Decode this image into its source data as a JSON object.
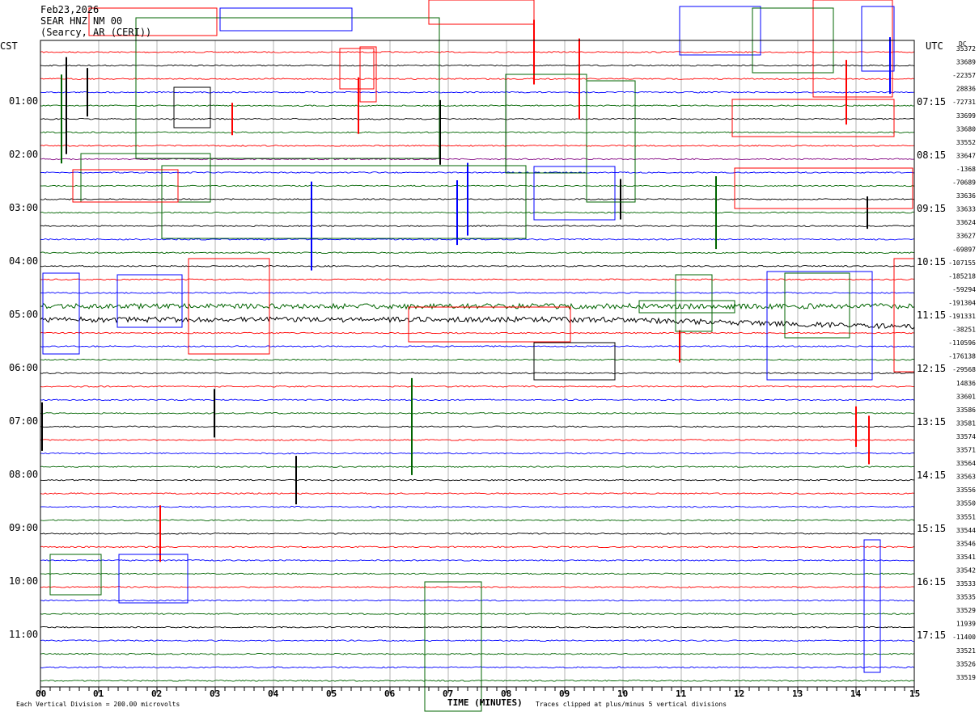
{
  "header": {
    "date": "Feb23,2026",
    "station": "SEAR HNZ NM 00",
    "location": "(Searcy, AR (CERI))"
  },
  "left_axis_title": "CST",
  "right_axis_title": "UTC",
  "dc_label": "DC",
  "footer": {
    "scale_note": "Each Vertical Division =  200.00 microvolts",
    "axis_title": "TIME (MINUTES)",
    "clip_note": "Traces clipped at plus/minus 5 vertical divisions"
  },
  "colors": {
    "palette": [
      "#000000",
      "#ff0000",
      "#0000ff",
      "#006400"
    ],
    "grid": "#808080",
    "background": "#ffffff"
  },
  "chart_data": {
    "type": "line",
    "chart_kind": "seismic helicorder",
    "x_ticks": [
      "00",
      "01",
      "02",
      "03",
      "04",
      "05",
      "06",
      "07",
      "08",
      "09",
      "10",
      "11",
      "12",
      "13",
      "14",
      "15"
    ],
    "x_range_minutes": [
      0,
      15
    ],
    "grid": true,
    "line_minutes": 15,
    "lines_per_hour": 4,
    "cst_hour_labels": [
      "01:00",
      "02:00",
      "03:00",
      "04:00",
      "05:00",
      "06:00",
      "07:00",
      "08:00",
      "09:00",
      "10:00",
      "11:00"
    ],
    "utc_hour_labels": [
      "07:15",
      "08:15",
      "09:15",
      "10:15",
      "11:15",
      "12:15",
      "13:15",
      "14:15",
      "15:15",
      "16:15",
      "17:15"
    ],
    "dc_offsets": [
      "35372",
      "33689",
      "-22357",
      "28836",
      "-72731",
      "33699",
      "33680",
      "33552",
      "33647",
      "-1368",
      "-70689",
      "33636",
      "33633",
      "33624",
      "33627",
      "-69897",
      "-107155",
      "-185218",
      "-59294",
      "-191304",
      "-191331",
      "-38251",
      "-110596",
      "-176138",
      "-29568",
      "14836",
      "33601",
      "33586",
      "33581",
      "33574",
      "33571",
      "33564",
      "33563",
      "33556",
      "33550",
      "33551",
      "33544",
      "33546",
      "33541",
      "33542",
      "33533",
      "33535",
      "33529",
      "11939",
      "-11400",
      "33521",
      "33526",
      "33519"
    ],
    "trace_colors": [
      "#ff0000",
      "#000000",
      "#ff0000",
      "#0000ff",
      "#006400",
      "#000000",
      "#006400",
      "#ff0000",
      "#800080",
      "#0000ff",
      "#006400",
      "#000000",
      "#006400",
      "#000000",
      "#0000ff",
      "#006400",
      "#000000",
      "#ff0000",
      "#0000ff",
      "#006400",
      "#000000",
      "#ff0000",
      "#0000ff",
      "#006400",
      "#000000",
      "#ff0000",
      "#0000ff",
      "#006400",
      "#000000",
      "#ff0000",
      "#0000ff",
      "#006400",
      "#000000",
      "#ff0000",
      "#0000ff",
      "#006400",
      "#000000",
      "#ff0000",
      "#0000ff",
      "#006400",
      "#ff0000",
      "#0000ff",
      "#006400",
      "#000000",
      "#0000ff",
      "#006400",
      "#0000ff",
      "#006400"
    ],
    "vertical_division_microvolts": 200.0,
    "clip_divisions": 5
  }
}
